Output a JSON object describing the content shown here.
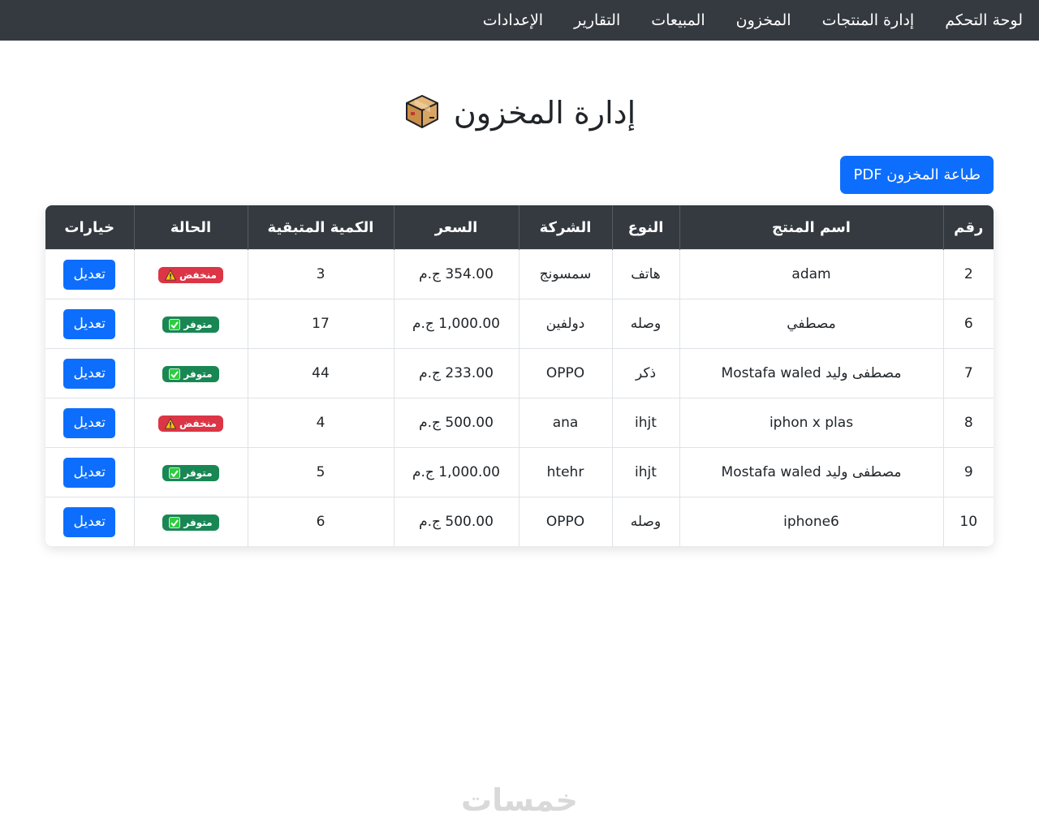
{
  "nav": {
    "items": [
      {
        "label": "لوحة التحكم"
      },
      {
        "label": "إدارة المنتجات"
      },
      {
        "label": "المخزون"
      },
      {
        "label": "المبيعات"
      },
      {
        "label": "التقارير"
      },
      {
        "label": "الإعدادات"
      }
    ]
  },
  "page": {
    "title": "إدارة المخزون",
    "title_icon": "package-box-icon",
    "print_button": "طباعة المخزون PDF"
  },
  "table": {
    "headers": [
      "رقم",
      "اسم المنتج",
      "النوع",
      "الشركة",
      "السعر",
      "الكمية المتبقية",
      "الحالة",
      "خيارات"
    ],
    "rows": [
      {
        "id": "2",
        "name": "adam",
        "type": "هاتف",
        "company": "سمسونج",
        "price": "354.00 ج.م",
        "qty": "3",
        "status": "منخفض",
        "status_kind": "low",
        "action": "تعديل"
      },
      {
        "id": "6",
        "name": "مصطفي",
        "type": "وصله",
        "company": "دولفين",
        "price": "1,000.00 ج.م",
        "qty": "17",
        "status": "متوفر",
        "status_kind": "ok",
        "action": "تعديل"
      },
      {
        "id": "7",
        "name": "مصطفى وليد Mostafa waled",
        "type": "ذكر",
        "company": "OPPO",
        "price": "233.00 ج.م",
        "qty": "44",
        "status": "متوفر",
        "status_kind": "ok",
        "action": "تعديل"
      },
      {
        "id": "8",
        "name": "iphon x plas",
        "type": "ihjt",
        "company": "ana",
        "price": "500.00 ج.م",
        "qty": "4",
        "status": "منخفض",
        "status_kind": "low",
        "action": "تعديل"
      },
      {
        "id": "9",
        "name": "مصطفى وليد Mostafa waled",
        "type": "ihjt",
        "company": "htehr",
        "price": "1,000.00 ج.م",
        "qty": "5",
        "status": "متوفر",
        "status_kind": "ok",
        "action": "تعديل"
      },
      {
        "id": "10",
        "name": "iphone6",
        "type": "وصله",
        "company": "OPPO",
        "price": "500.00 ج.م",
        "qty": "6",
        "status": "متوفر",
        "status_kind": "ok",
        "action": "تعديل"
      }
    ]
  },
  "colors": {
    "nav_bg": "#343a40",
    "primary": "#0d6efd",
    "danger": "#dc3545",
    "success": "#198754"
  },
  "watermark": "خمسات"
}
